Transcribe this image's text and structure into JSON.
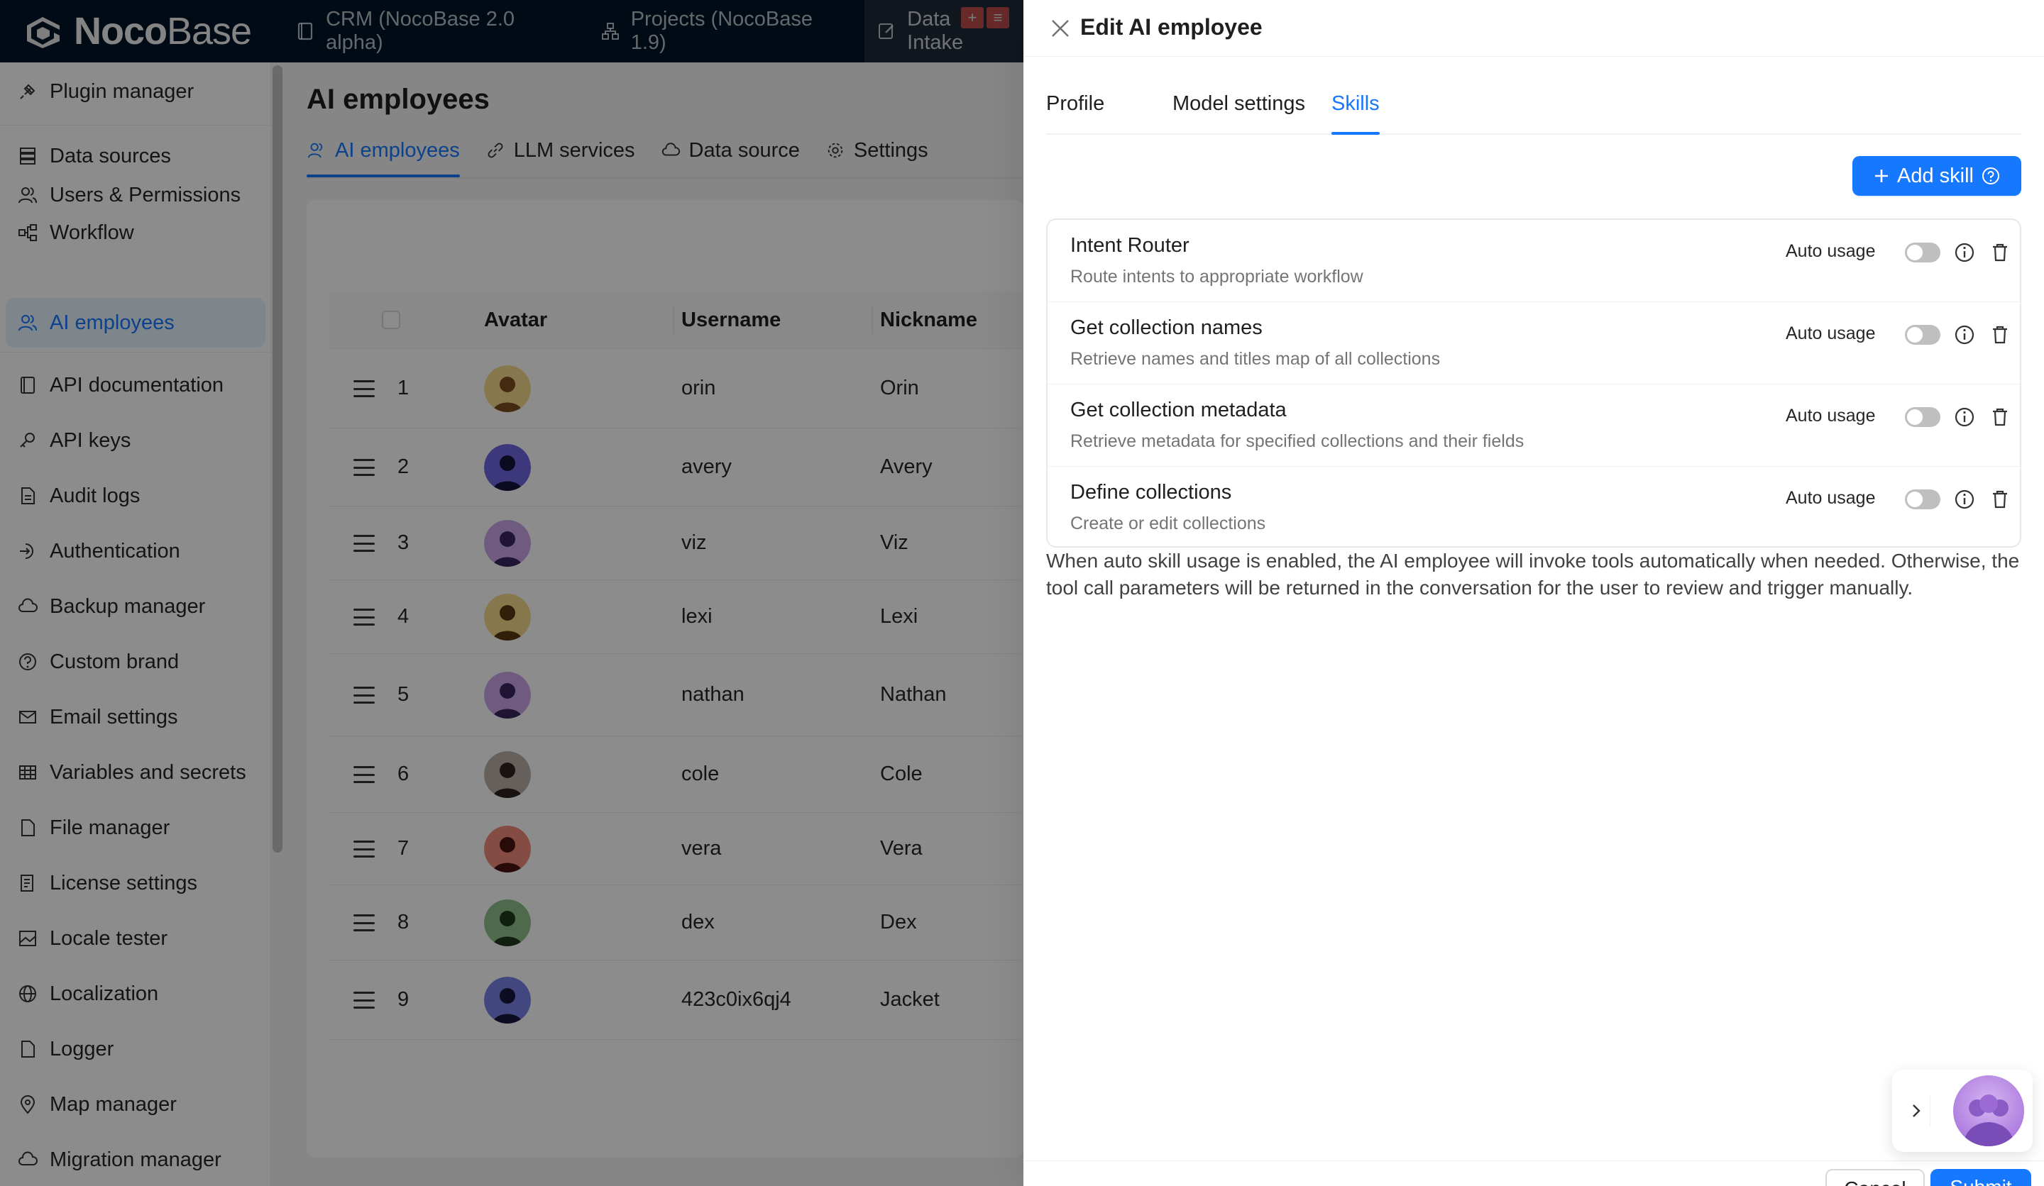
{
  "app": {
    "logo_bold": "Noco",
    "logo_light": "Base"
  },
  "topbar": {
    "items": [
      {
        "label": "CRM (NocoBase 2.0 alpha)",
        "icon": "book-icon"
      },
      {
        "label": "Projects (NocoBase 1.9)",
        "icon": "apartment-icon"
      },
      {
        "label": "Data Intake",
        "icon": "form-icon"
      }
    ]
  },
  "sidebar": {
    "items": [
      {
        "label": "Plugin manager",
        "icon": "plug-icon"
      },
      {
        "label": "Data sources",
        "icon": "database-icon"
      },
      {
        "label": "Users & Permissions",
        "icon": "users-icon"
      },
      {
        "label": "Workflow",
        "icon": "workflow-icon"
      },
      {
        "label": "AI employees",
        "icon": "robot-icon"
      },
      {
        "label": "API documentation",
        "icon": "book-icon"
      },
      {
        "label": "API keys",
        "icon": "key-icon"
      },
      {
        "label": "Audit logs",
        "icon": "file-icon"
      },
      {
        "label": "Authentication",
        "icon": "login-icon"
      },
      {
        "label": "Backup manager",
        "icon": "cloud-icon"
      },
      {
        "label": "Custom brand",
        "icon": "question-icon"
      },
      {
        "label": "Email settings",
        "icon": "mail-icon"
      },
      {
        "label": "Variables and secrets",
        "icon": "table-icon"
      },
      {
        "label": "File manager",
        "icon": "file-icon"
      },
      {
        "label": "License settings",
        "icon": "audit-icon"
      },
      {
        "label": "Locale tester",
        "icon": "image-icon"
      },
      {
        "label": "Localization",
        "icon": "globe-icon"
      },
      {
        "label": "Logger",
        "icon": "file-icon"
      },
      {
        "label": "Map manager",
        "icon": "pin-icon"
      },
      {
        "label": "Migration manager",
        "icon": "cloud-icon"
      }
    ]
  },
  "main": {
    "title": "AI employees",
    "tabs": [
      {
        "label": "AI employees",
        "icon": "robot-icon"
      },
      {
        "label": "LLM services",
        "icon": "link-icon"
      },
      {
        "label": "Data source",
        "icon": "cloud-icon"
      },
      {
        "label": "Settings",
        "icon": "gear-icon"
      }
    ],
    "table": {
      "columns": [
        "Avatar",
        "Username",
        "Nickname"
      ],
      "rows": [
        {
          "idx": "1",
          "username": "orin",
          "nickname": "Orin",
          "avatar_bg": "#f5d98a",
          "avatar_fg": "#7a4d1f"
        },
        {
          "idx": "2",
          "username": "avery",
          "nickname": "Avery",
          "avatar_bg": "#6f67e0",
          "avatar_fg": "#14133d"
        },
        {
          "idx": "3",
          "username": "viz",
          "nickname": "Viz",
          "avatar_bg": "#c8a6e8",
          "avatar_fg": "#3a2560"
        },
        {
          "idx": "4",
          "username": "lexi",
          "nickname": "Lexi",
          "avatar_bg": "#f5d98a",
          "avatar_fg": "#5a3a12"
        },
        {
          "idx": "5",
          "username": "nathan",
          "nickname": "Nathan",
          "avatar_bg": "#c8a6e8",
          "avatar_fg": "#3a2560"
        },
        {
          "idx": "6",
          "username": "cole",
          "nickname": "Cole",
          "avatar_bg": "#b8b0a8",
          "avatar_fg": "#2d2320"
        },
        {
          "idx": "7",
          "username": "vera",
          "nickname": "Vera",
          "avatar_bg": "#f08a7a",
          "avatar_fg": "#4a1510"
        },
        {
          "idx": "8",
          "username": "dex",
          "nickname": "Dex",
          "avatar_bg": "#8fc08a",
          "avatar_fg": "#1f3a1c"
        },
        {
          "idx": "9",
          "username": "423c0ix6qj4",
          "nickname": "Jacket",
          "avatar_bg": "#7b82e8",
          "avatar_fg": "#16183f"
        }
      ]
    }
  },
  "drawer": {
    "title": "Edit AI employee",
    "tabs": [
      "Profile",
      "Model settings",
      "Skills"
    ],
    "active_tab": "Skills",
    "add_skill_label": "Add skill",
    "auto_usage_label": "Auto usage",
    "skills": [
      {
        "title": "Intent Router",
        "description": "Route intents to appropriate workflow"
      },
      {
        "title": "Get collection names",
        "description": "Retrieve names and titles map of all collections"
      },
      {
        "title": "Get collection metadata",
        "description": "Retrieve metadata for specified collections and their fields"
      },
      {
        "title": "Define collections",
        "description": "Create or edit collections"
      }
    ],
    "hint": "When auto skill usage is enabled, the AI employee will invoke tools automatically when needed. Otherwise, the tool call parameters will be returned in the conversation for the user to review and trigger manually.",
    "cancel_label": "Cancel",
    "submit_label": "Submit"
  },
  "colors": {
    "primary": "#1677ff",
    "topbar_bg": "#001529"
  }
}
